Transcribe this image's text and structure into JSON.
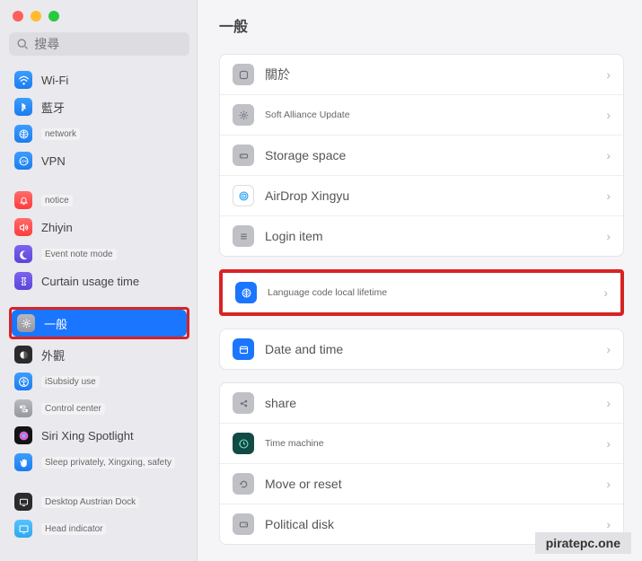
{
  "sidebar": {
    "search_placeholder": "搜尋",
    "groups": [
      [
        {
          "label": "Wi-Fi",
          "icon": "wifi",
          "cls": "i-blue"
        },
        {
          "label": "藍牙",
          "icon": "bluetooth",
          "cls": "i-blue"
        },
        {
          "label": "network",
          "icon": "globe",
          "cls": "i-blue",
          "small": true
        },
        {
          "label": "VPN",
          "icon": "vpn",
          "cls": "i-blue"
        }
      ],
      [
        {
          "label": "notice",
          "icon": "bell",
          "cls": "i-red",
          "small": true
        },
        {
          "label": "Zhiyin",
          "icon": "sound",
          "cls": "i-red"
        },
        {
          "label": "Event note mode",
          "icon": "moon",
          "cls": "i-purple",
          "small": true
        },
        {
          "label": "Curtain usage time",
          "icon": "hourglass",
          "cls": "i-purple"
        }
      ],
      [
        {
          "label": "一般",
          "icon": "gear",
          "cls": "i-gray",
          "selected": true,
          "highlight": true
        },
        {
          "label": "外觀",
          "icon": "appearance",
          "cls": "i-black"
        },
        {
          "label": "iSubsidy use",
          "icon": "accessibility",
          "cls": "i-blue",
          "small": true
        },
        {
          "label": "Control center",
          "icon": "switches",
          "cls": "i-gray",
          "small": true
        },
        {
          "label": "Siri Xing Spotlight",
          "icon": "siri",
          "cls": "i-dark"
        },
        {
          "label": "Sleep privately, Xingxing, safety",
          "icon": "hand",
          "cls": "i-blue",
          "small": true
        }
      ],
      [
        {
          "label": "Desktop Austrian Dock",
          "icon": "desktop",
          "cls": "i-black",
          "small": true
        },
        {
          "label": "Head indicator",
          "icon": "display",
          "cls": "i-lightblue",
          "small": true
        }
      ]
    ]
  },
  "main": {
    "title": "一般",
    "sections": [
      {
        "rows": [
          {
            "icon": "info",
            "cls": "ri-gray",
            "label": "關於"
          },
          {
            "icon": "gear",
            "cls": "ri-gray",
            "label": "Soft Alliance Update",
            "small": true
          },
          {
            "icon": "storage",
            "cls": "ri-gray",
            "label": "Storage space"
          },
          {
            "icon": "airdrop",
            "cls": "ri-white",
            "label": "AirDrop Xingyu"
          },
          {
            "icon": "list",
            "cls": "ri-gray",
            "label": "Login item"
          }
        ]
      },
      {
        "highlight": true,
        "rows": [
          {
            "icon": "globe",
            "cls": "ri-blue",
            "label": "Language code local lifetime",
            "small": true
          }
        ]
      },
      {
        "rows": [
          {
            "icon": "calendar",
            "cls": "ri-blue",
            "label": "Date and time"
          }
        ]
      },
      {
        "rows": [
          {
            "icon": "share",
            "cls": "ri-gray",
            "label": "share"
          },
          {
            "icon": "timemachine",
            "cls": "ri-darkgreen",
            "label": "Time machine",
            "small": true
          },
          {
            "icon": "reset",
            "cls": "ri-gray",
            "label": "Move or reset"
          },
          {
            "icon": "disk",
            "cls": "ri-gray",
            "label": "Political disk"
          }
        ]
      }
    ]
  },
  "watermark": "piratepc.one"
}
